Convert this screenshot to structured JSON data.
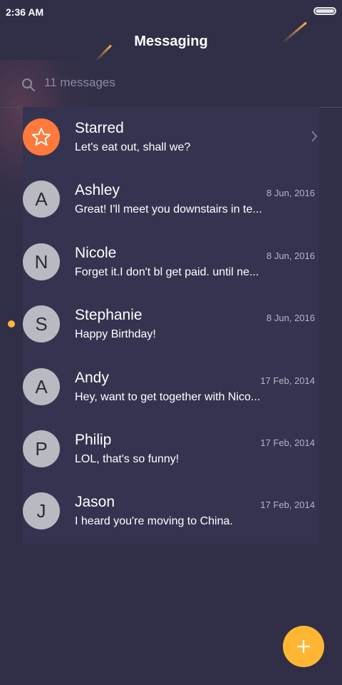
{
  "status_bar": {
    "time": "2:36 AM"
  },
  "header": {
    "title": "Messaging"
  },
  "search": {
    "text": "11 messages"
  },
  "colors": {
    "accent": "#ffb733",
    "starred": "#ff7a3c",
    "avatar": "#b9b9c2",
    "background": "#302f47"
  },
  "conversations": [
    {
      "icon": "star-icon",
      "name": "Starred",
      "preview": "Let's eat out, shall we?",
      "date": ""
    },
    {
      "initial": "A",
      "name": "Ashley",
      "preview": "Great! I'll meet you downstairs in te...",
      "date": "8 Jun, 2016"
    },
    {
      "initial": "N",
      "name": "Nicole",
      "preview": "Forget it.I don't bl get paid. until ne...",
      "date": "8 Jun, 2016"
    },
    {
      "initial": "S",
      "name": "Stephanie",
      "preview": "Happy Birthday!",
      "date": "8 Jun, 2016",
      "unread": true
    },
    {
      "initial": "A",
      "name": "Andy",
      "preview": "Hey, want to get together with Nico...",
      "date": "17 Feb, 2014"
    },
    {
      "initial": "P",
      "name": "Philip",
      "preview": "LOL, that's so funny!",
      "date": "17 Feb, 2014"
    },
    {
      "initial": "J",
      "name": "Jason",
      "preview": "I heard you're moving to China.",
      "date": "17 Feb, 2014"
    }
  ],
  "fab": {
    "icon": "plus-icon"
  }
}
